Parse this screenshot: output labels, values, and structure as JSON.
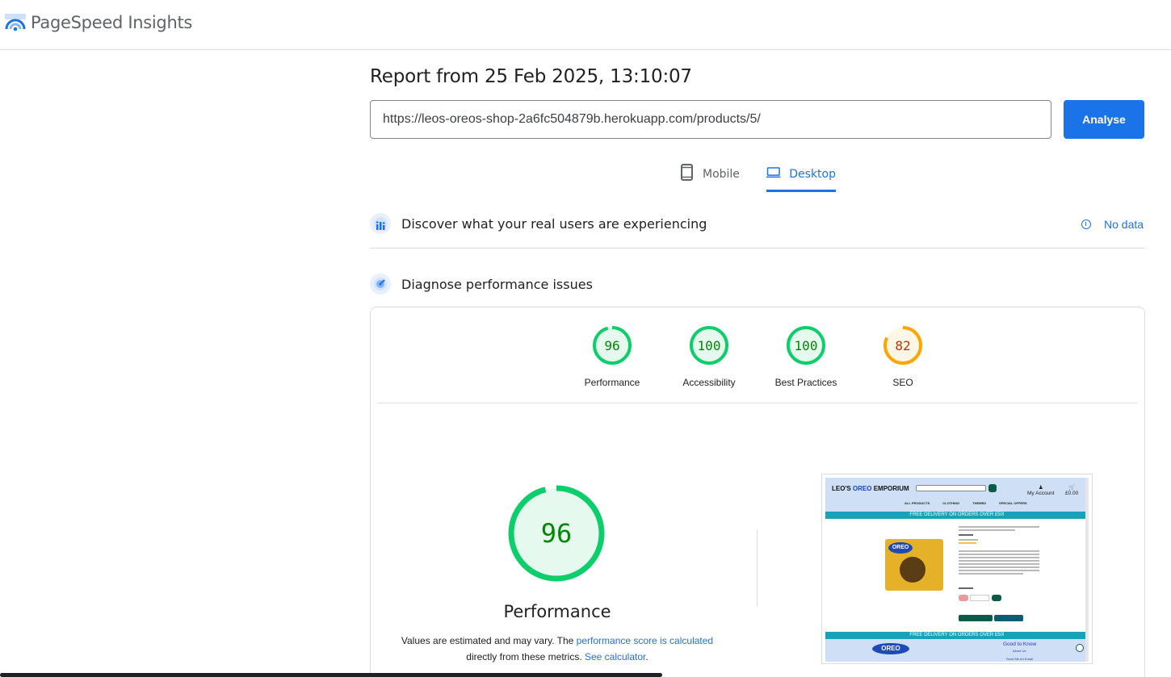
{
  "app": {
    "title": "PageSpeed Insights"
  },
  "report": {
    "title": "Report from 25 Feb 2025, 13:10:07"
  },
  "url_input": {
    "value": "https://leos-oreos-shop-2a6fc504879b.herokuapp.com/products/5/"
  },
  "analyse_button": {
    "label": "Analyse"
  },
  "tabs": [
    {
      "label": "Mobile",
      "icon": "phone-icon",
      "active": false
    },
    {
      "label": "Desktop",
      "icon": "laptop-icon",
      "active": true
    }
  ],
  "sections": {
    "real_users": {
      "label": "Discover what your real users are experiencing",
      "status": "No data"
    },
    "diagnose": {
      "label": "Diagnose performance issues"
    }
  },
  "scores": [
    {
      "label": "Performance",
      "value": "96",
      "color": "#0cce6b"
    },
    {
      "label": "Accessibility",
      "value": "100",
      "color": "#0cce6b"
    },
    {
      "label": "Best Practices",
      "value": "100",
      "color": "#0cce6b"
    },
    {
      "label": "SEO",
      "value": "82",
      "color": "#ffa400"
    }
  ],
  "performance": {
    "score": "96",
    "label": "Performance",
    "desc_prefix": "Values are estimated and may vary. The ",
    "desc_link1": "performance score is calculated",
    "desc_middle": " directly from these metrics. ",
    "desc_link2": "See calculator",
    "desc_suffix": "."
  },
  "screenshot": {
    "brand_part1": "LEO'S ",
    "brand_part2": "OREO",
    "brand_part3": " EMPORIUM",
    "account": "My Account",
    "cart": "£0.00",
    "nav": [
      "ALL PRODUCTS",
      "CLOTHING",
      "THEMED",
      "SPECIAL OFFERS"
    ],
    "banner": "FREE DELIVERY ON ORDERS OVER £50!",
    "product_logo": "OREO",
    "footer_logo": "OREO",
    "footer_heading": "Good to Know",
    "footer_about": "About Us",
    "footer_send": "Send Me An Email"
  },
  "colors": {
    "accent": "#1a73e8",
    "pass": "#0cce6b",
    "average": "#ffa400"
  }
}
